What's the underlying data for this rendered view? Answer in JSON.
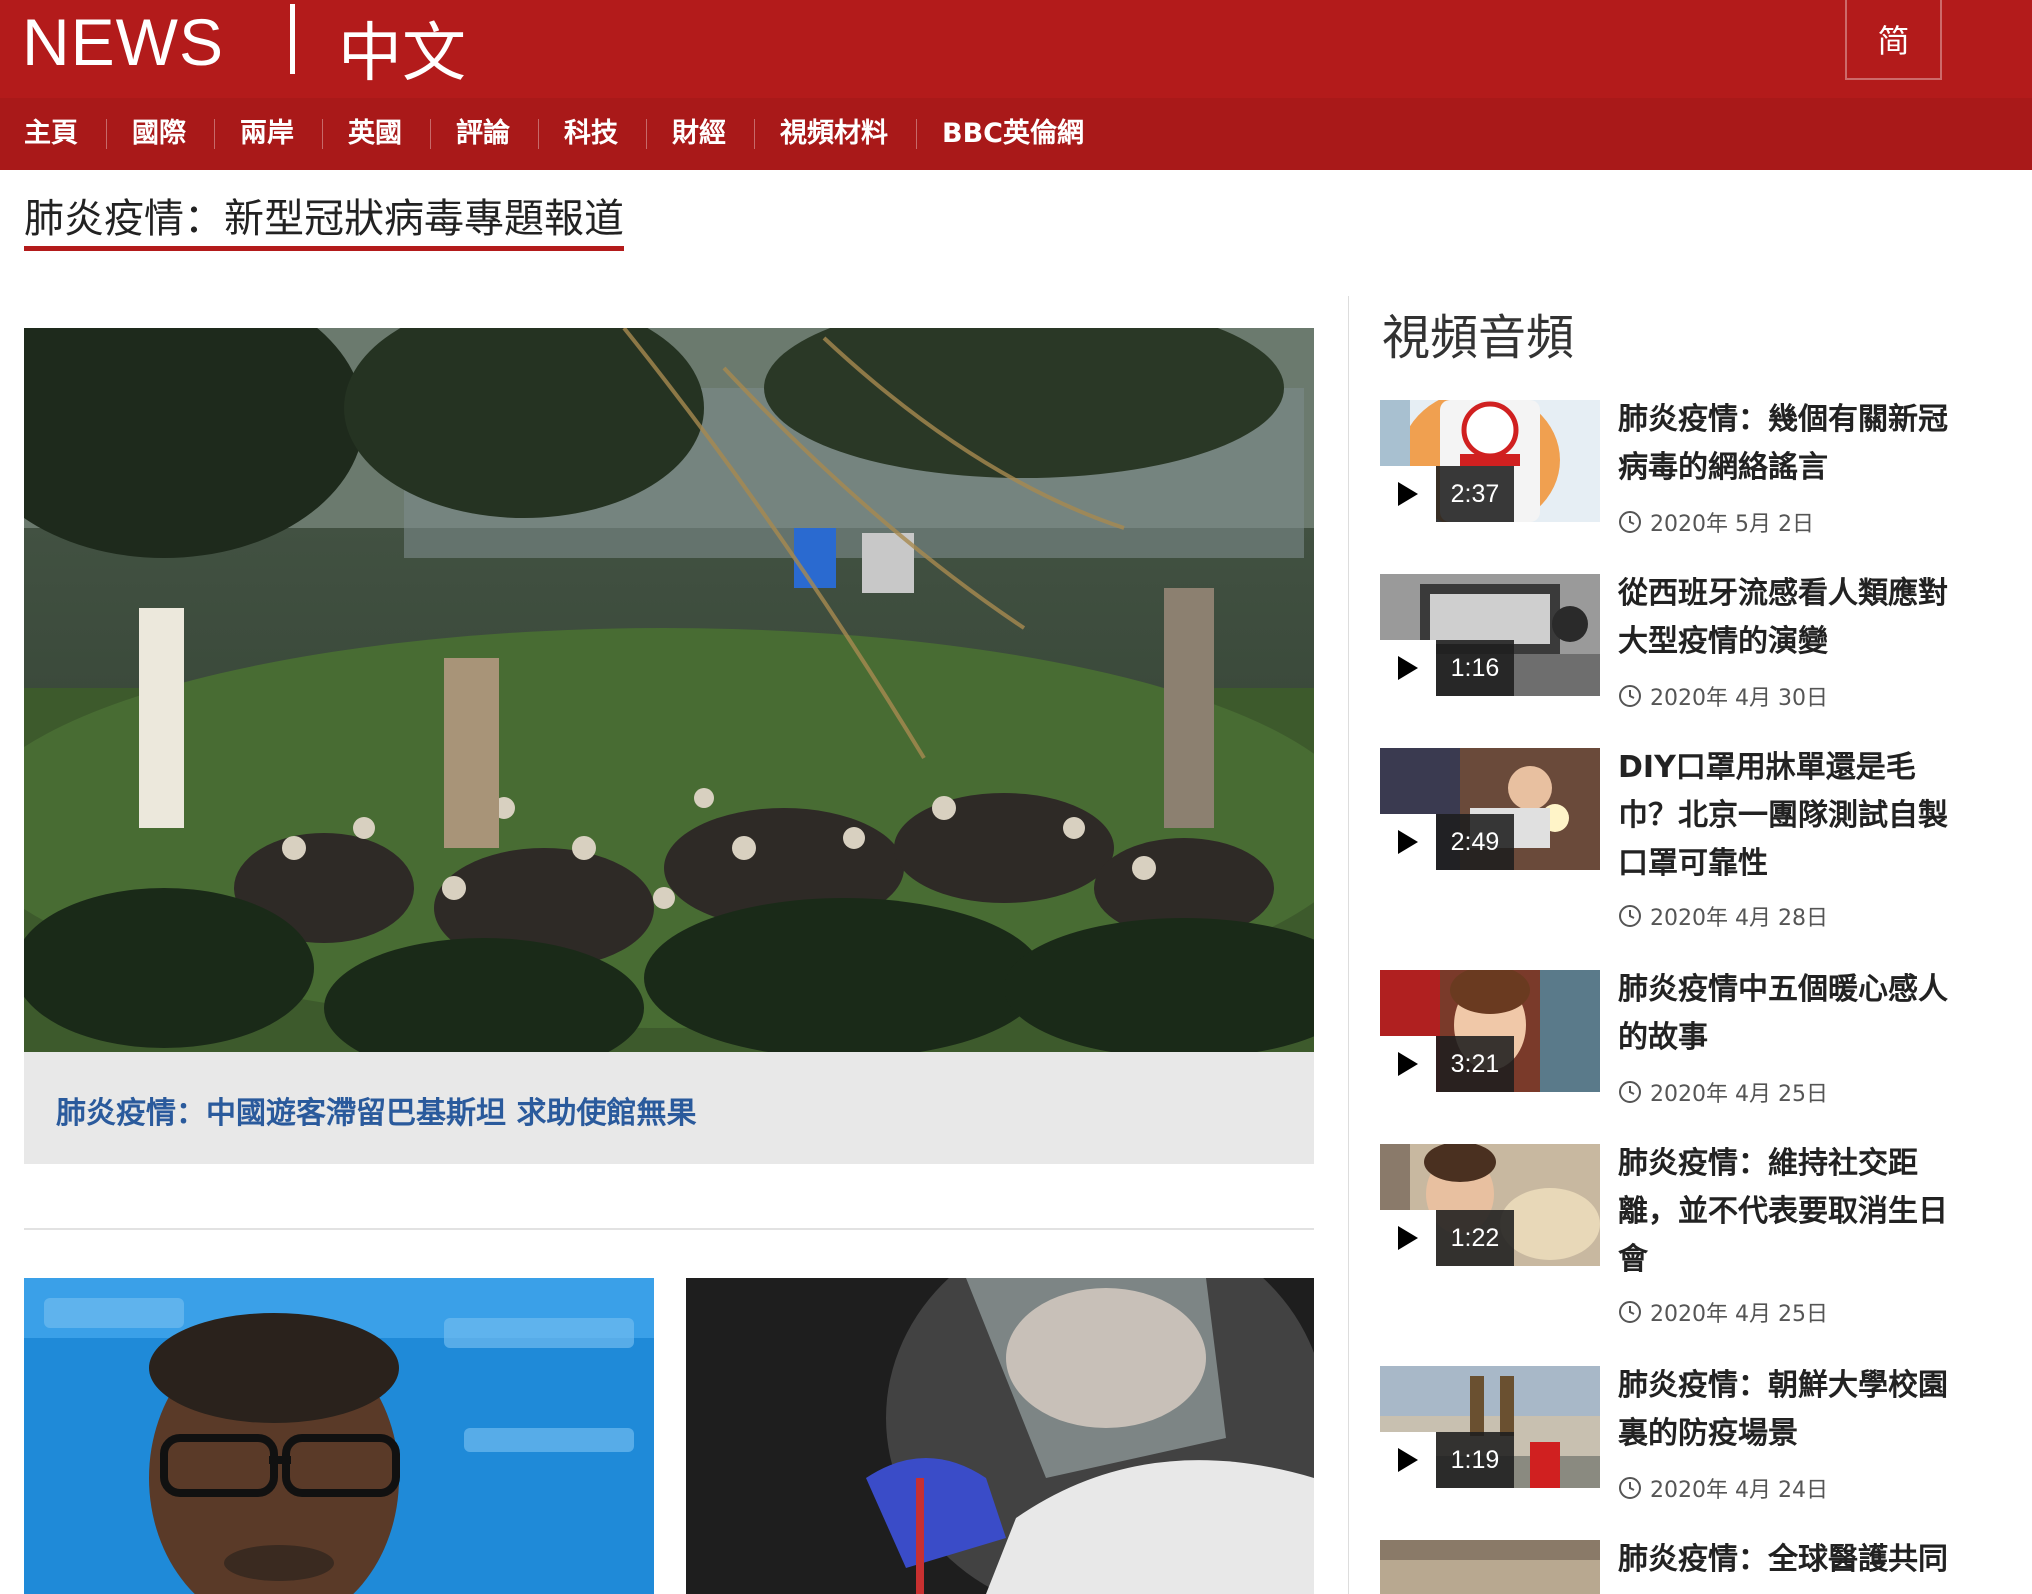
{
  "header": {
    "brand": "NEWS",
    "brand_sub": "中文",
    "lang_toggle": "简"
  },
  "nav": [
    "主頁",
    "國際",
    "兩岸",
    "英國",
    "評論",
    "科技",
    "財經",
    "視頻材料",
    "BBC英倫網"
  ],
  "page_title": "肺炎疫情：新型冠狀病毒專題報道",
  "hero": {
    "caption": "肺炎疫情：中國遊客滯留巴基斯坦 求助使館無果"
  },
  "sidebar": {
    "heading": "視頻音頻",
    "items": [
      {
        "title": "肺炎疫情：幾個有關新冠病毒的網絡謠言",
        "duration": "2:37",
        "date": "2020年 5月 2日"
      },
      {
        "title": "從西班牙流感看人類應對大型疫情的演變",
        "duration": "1:16",
        "date": "2020年 4月 30日"
      },
      {
        "title": "DIY口罩用牀單還是毛巾？北京一團隊測試自製口罩可靠性",
        "duration": "2:49",
        "date": "2020年 4月 28日"
      },
      {
        "title": "肺炎疫情中五個暖心感人的故事",
        "duration": "3:21",
        "date": "2020年 4月 25日"
      },
      {
        "title": "肺炎疫情：維持社交距離，並不代表要取消生日會",
        "duration": "1:22",
        "date": "2020年 4月 25日"
      },
      {
        "title": "肺炎疫情：朝鮮大學校園裏的防疫場景",
        "duration": "1:19",
        "date": "2020年 4月 24日"
      },
      {
        "title": "肺炎疫情：全球醫護共同",
        "duration": "",
        "date": ""
      }
    ]
  },
  "colors": {
    "brand_red": "#b31b1b",
    "nav_red": "#a91919",
    "link_blue": "#2a5a9c"
  }
}
